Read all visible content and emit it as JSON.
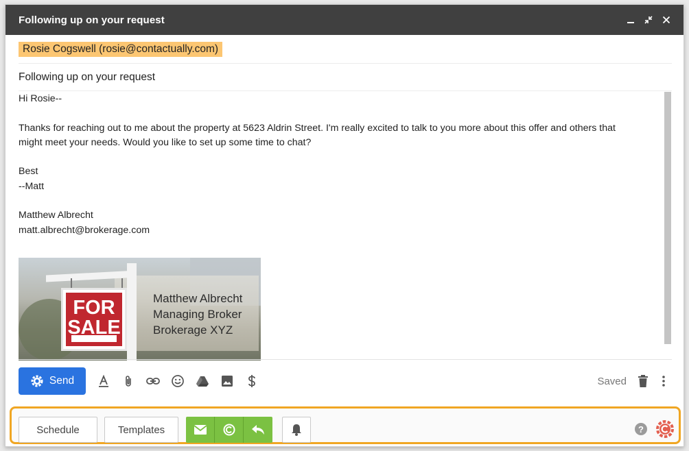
{
  "window": {
    "title": "Following up on your request"
  },
  "recipient": "Rosie Cogswell (rosie@contactually.com)",
  "subject": "Following up on your request",
  "body": {
    "greeting": "Hi Rosie--",
    "paragraph1_line1": "Thanks for reaching out to me about the property at 5623 Aldrin Street.  I'm really excited to talk to you more about this offer and others that",
    "paragraph1_line2": "might meet your needs.  Would you like to set up some time to chat?",
    "closing": "Best",
    "closing_name": "--Matt",
    "sig_name": "Matthew Albrecht",
    "sig_email": "matt.albrecht@brokerage.com"
  },
  "signature_image": {
    "sign_line1": "FOR",
    "sign_line2": "SALE",
    "text_line1": "Matthew Albrecht",
    "text_line2": "Managing Broker",
    "text_line3": "Brokerage XYZ"
  },
  "toolbar": {
    "send_label": "Send",
    "saved_label": "Saved",
    "icons": [
      "format-text-icon",
      "attach-icon",
      "link-icon",
      "emoji-icon",
      "drive-icon",
      "image-icon",
      "dollar-icon"
    ]
  },
  "extension": {
    "schedule_label": "Schedule",
    "templates_label": "Templates",
    "help_label": "?",
    "accent_color": "#f0a623",
    "green_color": "#7bc142"
  },
  "colors": {
    "titlebar": "#404040",
    "send_button": "#2a73e0",
    "recipient_highlight": "#fcc672"
  }
}
